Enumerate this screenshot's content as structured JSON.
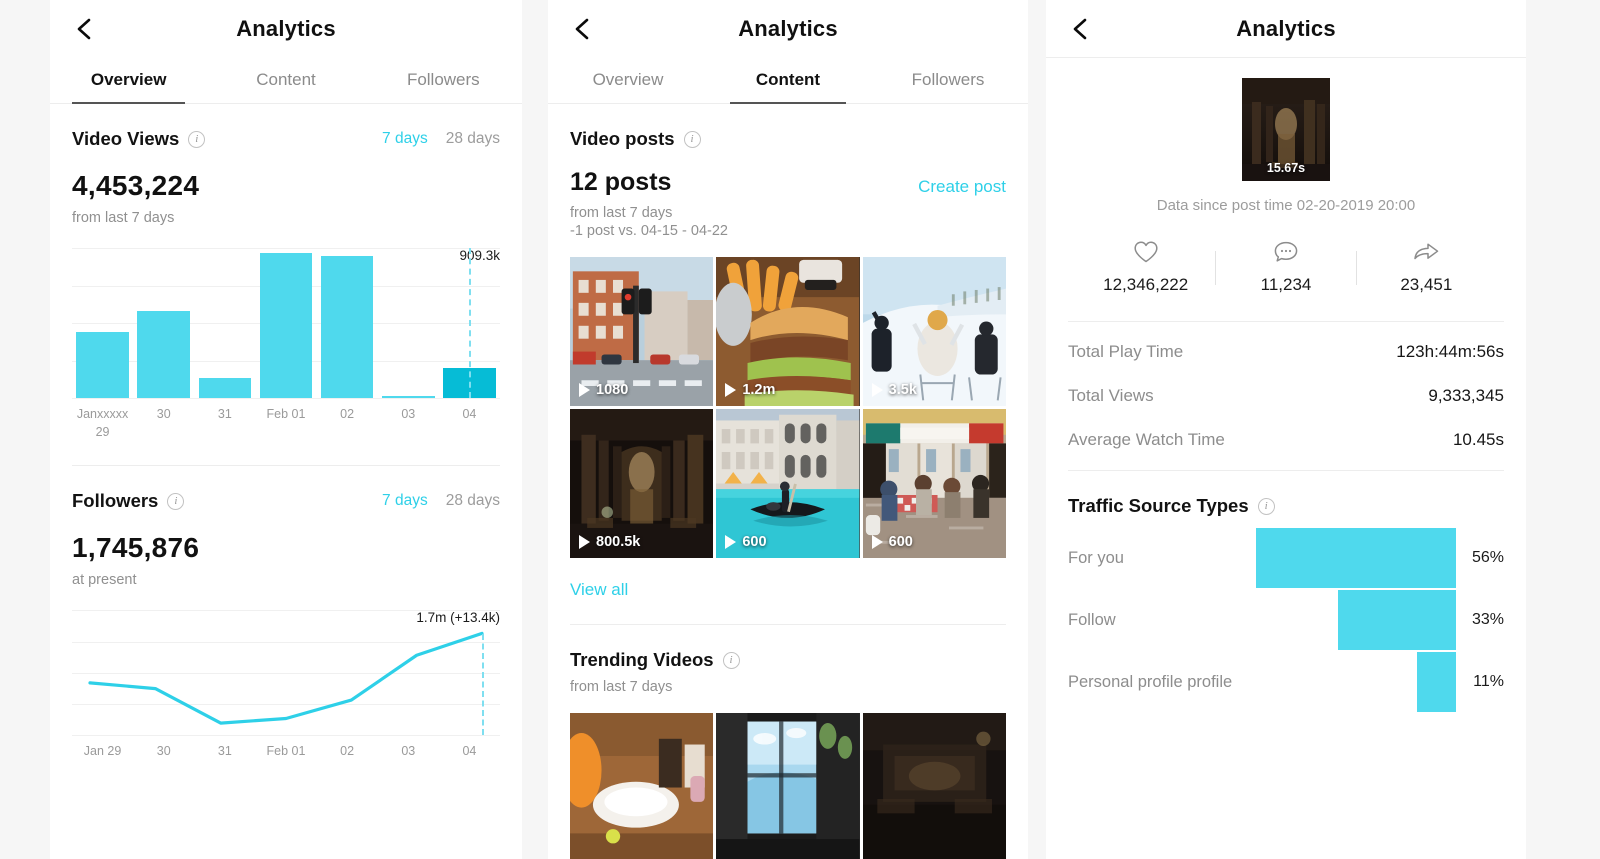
{
  "panels": {
    "overview": {
      "header": {
        "title": "Analytics",
        "back_icon": "chevron-left-icon"
      },
      "tabs": [
        {
          "label": "Overview",
          "active": true
        },
        {
          "label": "Content",
          "active": false
        },
        {
          "label": "Followers",
          "active": false
        }
      ],
      "video_views": {
        "title": "Video Views",
        "info_icon": "info-icon",
        "range_7": "7 days",
        "range_28": "28 days",
        "value": "4,453,224",
        "caption": "from last 7 days",
        "peak_label": "909.3k"
      },
      "followers": {
        "title": "Followers",
        "info_icon": "info-icon",
        "range_7": "7 days",
        "range_28": "28 days",
        "value": "1,745,876",
        "caption": "at present",
        "peak_label": "1.7m (+13.4k)"
      }
    },
    "content": {
      "header": {
        "title": "Analytics",
        "back_icon": "chevron-left-icon"
      },
      "tabs": [
        {
          "label": "Overview",
          "active": false
        },
        {
          "label": "Content",
          "active": true
        },
        {
          "label": "Followers",
          "active": false
        }
      ],
      "video_posts": {
        "title": "Video posts",
        "info_icon": "info-icon",
        "count": "12 posts",
        "create_post": "Create post",
        "caption1": "from last 7 days",
        "caption2": "-1 post vs. 04-15 - 04-22",
        "view_all": "View all",
        "thumbs": [
          {
            "plays": "1080",
            "scene": "city-street"
          },
          {
            "plays": "1.2m",
            "scene": "burger"
          },
          {
            "plays": "3.5k",
            "scene": "snow-hill"
          },
          {
            "plays": "800.5k",
            "scene": "corridor"
          },
          {
            "plays": "600",
            "scene": "venice-canal"
          },
          {
            "plays": "600",
            "scene": "cafe-terrace"
          }
        ]
      },
      "trending": {
        "title": "Trending Videos",
        "info_icon": "info-icon",
        "caption": "from last 7 days",
        "thumbs": [
          {
            "scene": "table-orange"
          },
          {
            "scene": "window-blue"
          },
          {
            "scene": "dark-room"
          }
        ]
      }
    },
    "video": {
      "header": {
        "title": "Analytics",
        "back_icon": "chevron-left-icon"
      },
      "hero": {
        "duration": "15.67s",
        "caption": "Data since post time 02-20-2019 20:00"
      },
      "engagement": [
        {
          "icon": "heart-icon",
          "value": "12,346,222"
        },
        {
          "icon": "comment-icon",
          "value": "11,234"
        },
        {
          "icon": "share-icon",
          "value": "23,451"
        }
      ],
      "metrics": [
        {
          "label": "Total Play Time",
          "value": "123h:44m:56s"
        },
        {
          "label": "Total Views",
          "value": "9,333,345"
        },
        {
          "label": "Average Watch Time",
          "value": "10.45s"
        }
      ],
      "traffic": {
        "title": "Traffic Source Types",
        "info_icon": "info-icon"
      }
    }
  },
  "chart_data": [
    {
      "type": "bar",
      "title": "Video Views",
      "categories": [
        "Janxxxxx\n29",
        "30",
        "31",
        "Feb 01",
        "02",
        "03",
        "04"
      ],
      "tick_labels": [
        "Janxxxxx 29",
        "30",
        "31",
        "Feb 01",
        "02",
        "03",
        "04"
      ],
      "values": [
        443,
        578,
        136,
        966,
        944,
        9,
        202
      ],
      "values_display": [
        "443k",
        "578k",
        "136k",
        "966k",
        "944k",
        "9k",
        "202k"
      ],
      "highlight_index": 6,
      "annotation": "909.3k",
      "annotation_index": 6,
      "bar_color": "#4fd9ed",
      "highlight_color": "#06bcd6",
      "gridlines": 5,
      "grid": true,
      "ylim": [
        0,
        1000
      ],
      "xlabel": "",
      "ylabel": ""
    },
    {
      "type": "line",
      "title": "Followers",
      "x": [
        "Jan 29",
        "30",
        "31",
        "Feb 01",
        "02",
        "03",
        "04"
      ],
      "values": [
        41,
        36,
        6,
        10,
        26,
        65,
        84
      ],
      "annotation": "1.7m (+13.4k)",
      "annotation_index": 6,
      "line_color": "#2ed0e8",
      "gridlines": 5,
      "grid": true,
      "ylim": [
        0,
        100
      ],
      "xlabel": "",
      "ylabel": ""
    },
    {
      "type": "bar",
      "orientation": "horizontal-right-aligned",
      "title": "Traffic Source Types",
      "categories": [
        "For you",
        "Follow",
        "Personal profile profile"
      ],
      "values": [
        56,
        33,
        11
      ],
      "value_labels": [
        "56%",
        "33%",
        "11%"
      ],
      "bar_color": "#4fd9ed",
      "ylim": [
        0,
        100
      ],
      "grid": false
    }
  ]
}
